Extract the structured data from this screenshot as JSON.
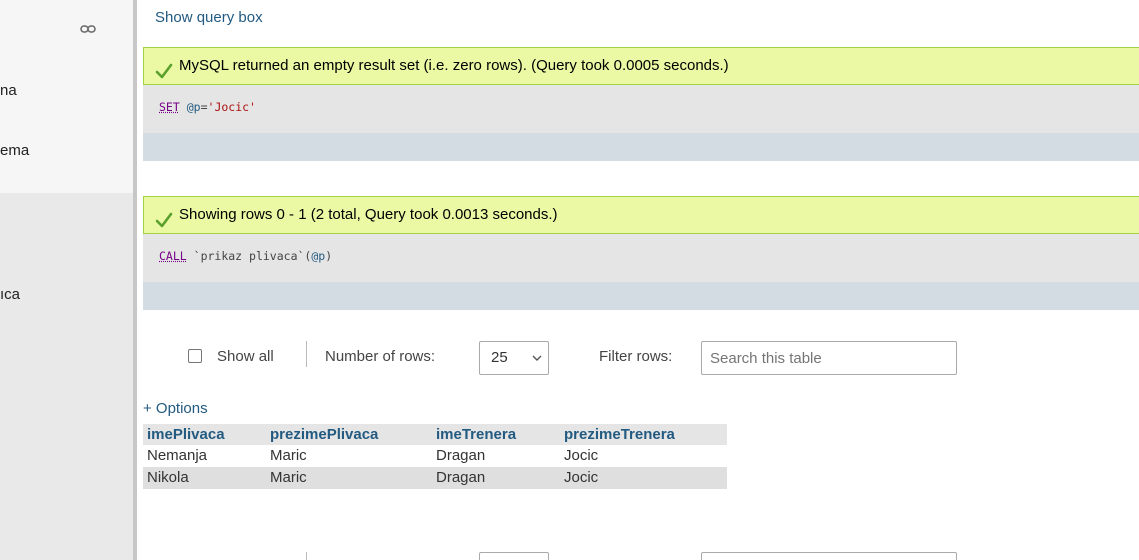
{
  "sidebar": {
    "items": [
      {
        "label": "na"
      },
      {
        "label": "ema"
      },
      {
        "label": "ıca"
      }
    ]
  },
  "show_query_box": "Show query box",
  "queries": [
    {
      "message": "MySQL returned an empty result set (i.e. zero rows). (Query took 0.0005 seconds.)",
      "sql": {
        "keyword": "SET",
        "variable": "@p",
        "equals": "=",
        "string": "'Jocic'"
      }
    },
    {
      "message": "Showing rows 0 - 1 (2 total, Query took 0.0013 seconds.)",
      "sql": {
        "keyword": "CALL",
        "procedure": "`prikaz plivaca`",
        "open": "(",
        "variable": "@p",
        "close": ")"
      }
    }
  ],
  "controls": {
    "show_all_label": "Show all",
    "number_of_rows_label": "Number of rows:",
    "number_of_rows_value": "25",
    "filter_rows_label": "Filter rows:",
    "search_placeholder": "Search this table"
  },
  "options_label": "+ Options",
  "table": {
    "headers": [
      "imePlivaca",
      "prezimePlivaca",
      "imeTrenera",
      "prezimeTrenera"
    ],
    "rows": [
      [
        "Nemanja",
        "Maric",
        "Dragan",
        "Jocic"
      ],
      [
        "Nikola",
        "Maric",
        "Dragan",
        "Jocic"
      ]
    ]
  },
  "colors": {
    "success_bg": "#ebf8a4",
    "success_border": "#a2d246",
    "link": "#235a81",
    "sql_keyword": "#770088",
    "sql_string": "#aa1111"
  }
}
